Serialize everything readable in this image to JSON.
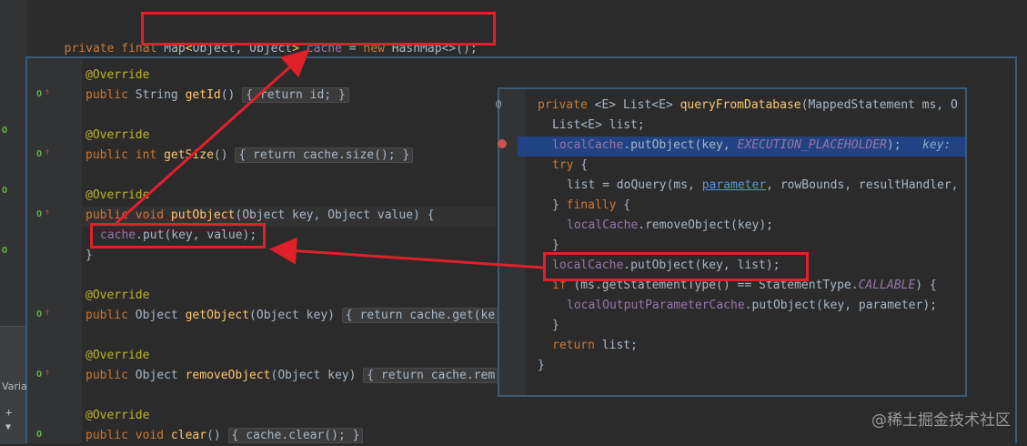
{
  "top_editor": {
    "line": {
      "kw_private": "private",
      "kw_final": "final",
      "type": "Map",
      "lt": "<",
      "gen_args": "Object, Object",
      "gt": ">",
      "field": "cache",
      "eq": " = ",
      "kw_new": "new",
      "ctor": " HashMap<>();"
    }
  },
  "impl_popup": {
    "lines": {
      "l1_ann": "@Override",
      "l2_kw": "public",
      "l2_type": " String ",
      "l2_fn": "getId",
      "l2_rest": "() ",
      "l2_fold": "{ return id; }",
      "l4_ann": "@Override",
      "l5_kw": "public int",
      "l5_fn": "getSize",
      "l5_rest": "() ",
      "l5_fold": "{ return cache.size(); }",
      "l7_ann": "@Override",
      "l8_kw": "public void",
      "l8_fn": "putObject",
      "l8_rest": "(Object key, Object value) {",
      "l9_fld": "cache",
      "l9_rest": ".put(key, value);",
      "l10": "}",
      "l12_ann": "@Override",
      "l13_kw": "public",
      "l13_type": " Object ",
      "l13_fn": "getObject",
      "l13_rest": "(Object key) ",
      "l13_fold": "{ return cache.get(ke",
      "l15_ann": "@Override",
      "l16_kw": "public",
      "l16_type": " Object ",
      "l16_fn": "removeObject",
      "l16_rest": "(Object key) ",
      "l16_fold": "{ return cache.rem",
      "l18_ann": "@Override",
      "l19_kw": "public void",
      "l19_fn": "clear",
      "l19_rest": "() ",
      "l19_fold": "{ cache.clear(); }"
    }
  },
  "query_popup": {
    "lines": {
      "q1_kw": "private",
      "q1_gen": " <E> ",
      "q1_type": "List<E> ",
      "q1_fn": "queryFromDatabase",
      "q1_rest": "(MappedStatement ms, O",
      "q2": "List<E> list;",
      "q3_fld": "localCache",
      "q3_mid": ".putObject(key, ",
      "q3_const": "EXECUTION_PLACEHOLDER",
      "q3_end": ");",
      "q3_hint": "key:",
      "q4_kw": "try",
      "q4_rest": " {",
      "q5_a": "list = doQuery(ms, ",
      "q5_param": "parameter",
      "q5_b": ", rowBounds, resultHandler,",
      "q6_a": "} ",
      "q6_kw": "finally",
      "q6_brace": " {",
      "q7_fld": "localCache",
      "q7_rest": ".removeObject(key);",
      "q8": "}",
      "q9_fld": "localCache",
      "q9_rest": ".putObject(key, list);",
      "q10_kw": "if",
      "q10_a": " (ms.getStatementType() == StatementType.",
      "q10_const": "CALLABLE",
      "q10_b": ") {",
      "q11_fld": "localOutputParameterCache",
      "q11_rest": ".putObject(key, parameter);",
      "q12": "}",
      "q13_kw": "return",
      "q13_rest": " list;",
      "q14": "}"
    }
  },
  "side_panel": {
    "label": "Varia"
  },
  "watermark": "@稀土掘金技术社区",
  "colors": {
    "annotation_box": "#e0202a",
    "highlight": "#214283"
  }
}
